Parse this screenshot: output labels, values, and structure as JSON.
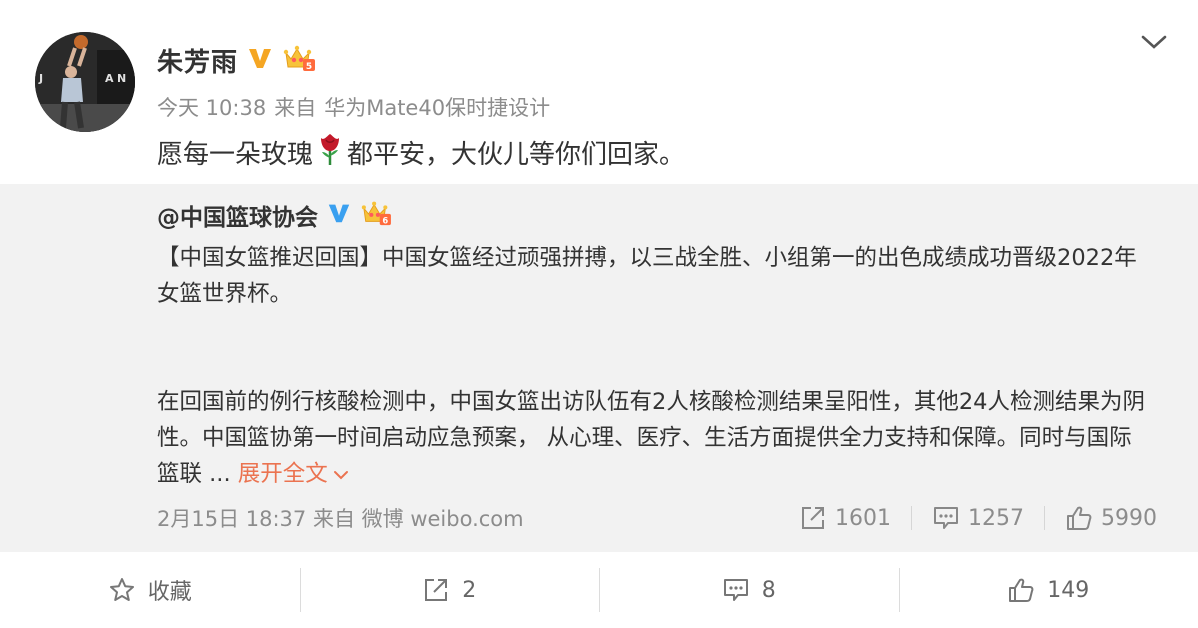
{
  "post": {
    "username": "朱芳雨",
    "time": "今天 10:38",
    "from_label": "来自",
    "source": "华为Mate40保时捷设计",
    "text_before": "愿每一朵玫瑰",
    "text_after": "都平安，大伙儿等你们回家。"
  },
  "repost": {
    "author": "@中国篮球协会",
    "para1": "【中国女篮推迟回国】中国女篮经过顽强拼搏，以三战全胜、小组第一的出色成绩成功晋级2022年女篮世界杯。",
    "para2": "在回国前的例行核酸检测中，中国女篮出访队伍有2人核酸检测结果呈阳性，其他24人检测结果为阴性。中国篮协第一时间启动应急预案， 从心理、医疗、生活方面提供全力支持和保障。同时与国际篮联 ...",
    "expand_label": "展开全文",
    "time": "2月15日 18:37",
    "from_label": "来自",
    "source": "微博 weibo.com",
    "reposts": "1601",
    "comments": "1257",
    "likes": "5990"
  },
  "actions": {
    "favorite_label": "收藏",
    "repost_count": "2",
    "comment_count": "8",
    "like_count": "149"
  },
  "colors": {
    "accent": "#eb7350",
    "verified_gold": "#f5a623",
    "verified_blue": "#3aa0f0",
    "meta_gray": "#8c8c8c",
    "repost_bg": "#f2f2f2"
  },
  "icons": {
    "avatar": "player-shooting-photo",
    "verified_personal": "v-gold-icon",
    "verified_org": "v-blue-icon",
    "member": "crown-member-icon",
    "rose": "rose-emoji",
    "chevron": "chevron-down-icon",
    "repost": "share-icon",
    "comment": "comment-icon",
    "like": "thumbs-up-icon",
    "favorite": "star-icon"
  }
}
